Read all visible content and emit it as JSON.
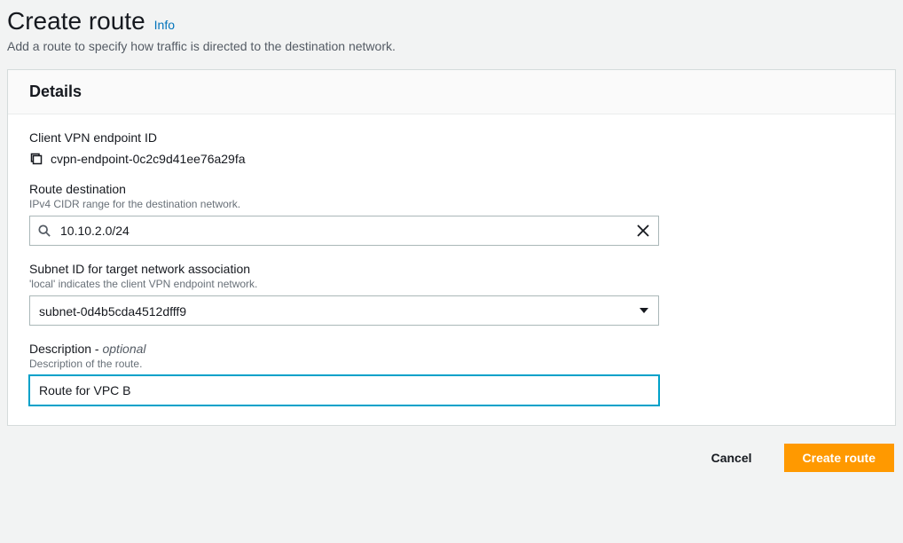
{
  "header": {
    "title": "Create route",
    "info": "Info",
    "subtitle": "Add a route to specify how traffic is directed to the destination network."
  },
  "panel": {
    "title": "Details",
    "endpoint": {
      "label": "Client VPN endpoint ID",
      "value": "cvpn-endpoint-0c2c9d41ee76a29fa"
    },
    "destination": {
      "label": "Route destination",
      "hint": "IPv4 CIDR range for the destination network.",
      "value": "10.10.2.0/24"
    },
    "subnet": {
      "label": "Subnet ID for target network association",
      "hint": "'local' indicates the client VPN endpoint network.",
      "value": "subnet-0d4b5cda4512dfff9"
    },
    "description": {
      "label": "Description",
      "suffix": " - ",
      "optional": "optional",
      "hint": "Description of the route.",
      "value": "Route for VPC B"
    }
  },
  "footer": {
    "cancel": "Cancel",
    "create": "Create route"
  }
}
